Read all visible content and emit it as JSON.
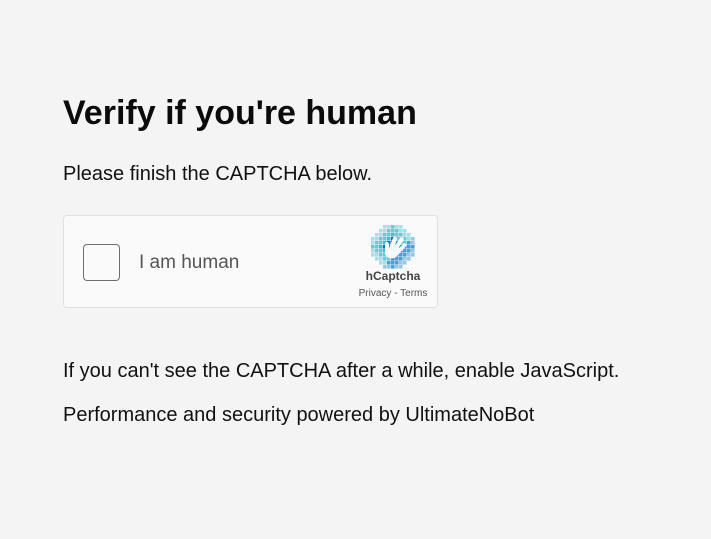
{
  "page": {
    "title": "Verify if you're human",
    "subtitle": "Please finish the CAPTCHA below.",
    "note": "If you can't see the CAPTCHA after a while, enable JavaScript.",
    "powered_by": "Performance and security powered by UltimateNoBot"
  },
  "captcha": {
    "checkbox_label": "I am human",
    "checked": false,
    "brand": "hCaptcha",
    "logo_icon": "hcaptcha-hand-icon",
    "privacy_label": "Privacy",
    "separator": "-",
    "terms_label": "Terms",
    "colors": {
      "logo_light": "#3fc1c9",
      "logo_dark": "#1f8cc7",
      "logo_accent": "#0074bf"
    }
  }
}
